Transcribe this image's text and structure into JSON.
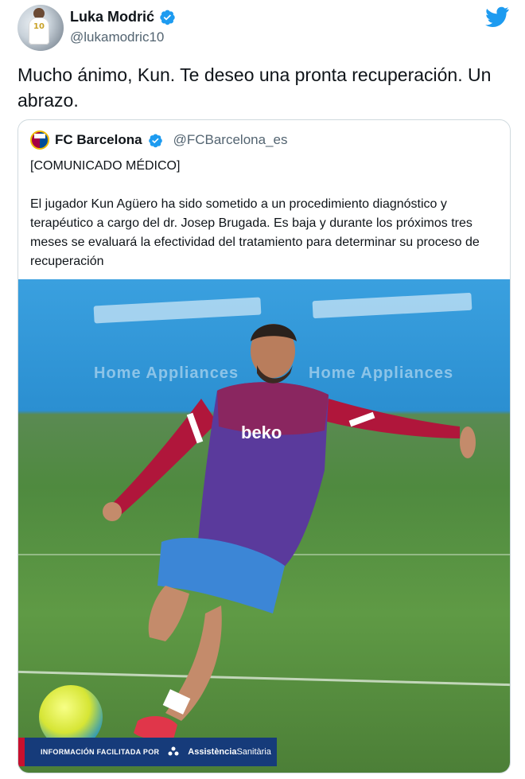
{
  "author": {
    "name": "Luka Modrić",
    "handle": "@lukamodric10",
    "avatar_icon": "avatar-photo"
  },
  "tweet": {
    "text": "Mucho ánimo, Kun. Te deseo una pronta recuperación. Un abrazo."
  },
  "quoted": {
    "name": "FC Barcelona",
    "handle": "@FCBarcelona_es",
    "title": "[COMUNICADO MÉDICO]",
    "body": "El jugador Kun Agüero ha sido sometido a un procedimiento diagnóstico y terapéutico a cargo del dr. Josep Brugada. Es baja y durante los próximos tres meses se evaluará la efectividad del tratamiento para determinar su proceso de recuperación",
    "photo": {
      "shirt_sponsor": "beko",
      "board_text_left": "Home Appliances",
      "board_text_right": "Home Appliances",
      "banner_label": "INFORMACIÓN FACILITADA POR",
      "banner_brand": "Assistència",
      "banner_brand_sub": "Sanitària"
    }
  },
  "colors": {
    "twitter_blue": "#1d9bf0",
    "text_primary": "#0f1419",
    "text_secondary": "#536471",
    "barca_red": "#a50044",
    "barca_blue": "#004d98"
  },
  "icons": [
    "verified-badge-icon",
    "twitter-bird-icon",
    "fc-barcelona-crest-icon"
  ]
}
